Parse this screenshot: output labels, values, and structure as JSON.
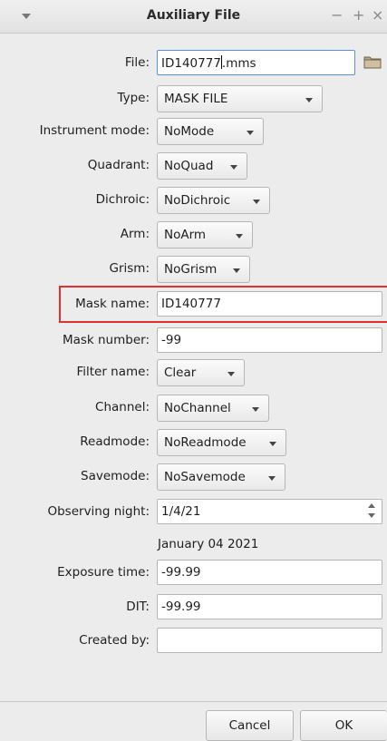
{
  "window": {
    "title": "Auxiliary File",
    "controls": [
      "−",
      "+",
      "×"
    ]
  },
  "form": {
    "file": {
      "label": "File:",
      "value_before_cursor": "ID140777",
      "value_after_cursor": ".mms"
    },
    "type": {
      "label": "Type:",
      "value": "MASK FILE"
    },
    "instrument_mode": {
      "label": "Instrument mode:",
      "value": "NoMode"
    },
    "quadrant": {
      "label": "Quadrant:",
      "value": "NoQuad"
    },
    "dichroic": {
      "label": "Dichroic:",
      "value": "NoDichroic"
    },
    "arm": {
      "label": "Arm:",
      "value": "NoArm"
    },
    "grism": {
      "label": "Grism:",
      "value": "NoGrism"
    },
    "mask_name": {
      "label": "Mask name:",
      "value": "ID140777"
    },
    "mask_number": {
      "label": "Mask number:",
      "value": "-99"
    },
    "filter_name": {
      "label": "Filter name:",
      "value": "Clear"
    },
    "channel": {
      "label": "Channel:",
      "value": "NoChannel"
    },
    "readmode": {
      "label": "Readmode:",
      "value": "NoReadmode"
    },
    "savemode": {
      "label": "Savemode:",
      "value": "NoSavemode"
    },
    "observing_night": {
      "label": "Observing night:",
      "value": "1/4/21",
      "long_date": "January 04 2021"
    },
    "exposure_time": {
      "label": "Exposure time:",
      "value": "-99.99"
    },
    "dit": {
      "label": "DIT:",
      "value": "-99.99"
    },
    "created_by": {
      "label": "Created by:",
      "value": ""
    }
  },
  "buttons": {
    "cancel": "Cancel",
    "ok": "OK"
  },
  "icons": {
    "browse": "folder-icon",
    "menu": "window-menu-icon"
  },
  "colors": {
    "highlight": "#e03030",
    "background": "#ececec"
  }
}
